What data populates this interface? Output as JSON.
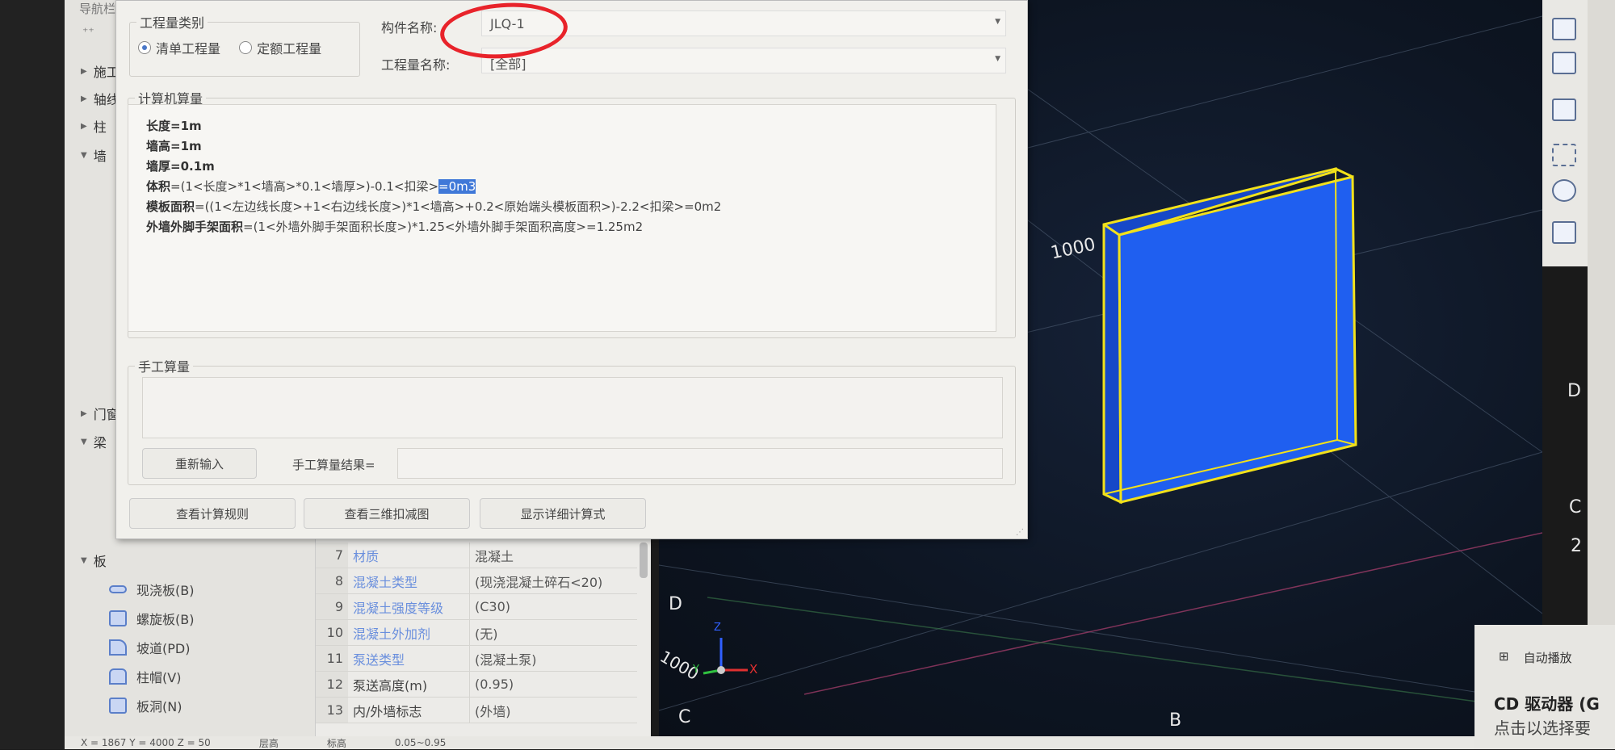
{
  "nav": {
    "title": "导航栏",
    "items": [
      {
        "label": "施工",
        "expanded": false
      },
      {
        "label": "轴线",
        "expanded": false
      },
      {
        "label": "柱",
        "expanded": false
      },
      {
        "label": "墙",
        "expanded": true
      },
      {
        "label": "门窗",
        "expanded": false
      },
      {
        "label": "梁",
        "expanded": true
      },
      {
        "label": "板",
        "expanded": true
      }
    ],
    "slab_items": [
      {
        "label": "现浇板(B)",
        "icon": "cast-slab-icon"
      },
      {
        "label": "螺旋板(B)",
        "icon": "spiral-slab-icon"
      },
      {
        "label": "坡道(PD)",
        "icon": "ramp-icon"
      },
      {
        "label": "柱帽(V)",
        "icon": "column-cap-icon"
      },
      {
        "label": "板洞(N)",
        "icon": "slab-hole-icon"
      }
    ]
  },
  "dialog": {
    "category_legend": "工程量类别",
    "radio_bill": "清单工程量",
    "radio_quota": "定额工程量",
    "selected": "清单工程量",
    "component_label": "构件名称:",
    "component_value": "JLQ-1",
    "quantity_label": "工程量名称:",
    "quantity_value": "[全部]",
    "computer_legend": "计算机算量",
    "lines": {
      "l1": "长度=1m",
      "l2": "墙高=1m",
      "l3": "墙厚=0.1m",
      "l4a": "体积",
      "l4b": "=(1<长度>*1<墙高>*0.1<墙厚>)-0.1<扣梁>",
      "l4c": "=0m3",
      "l5a": "模板面积",
      "l5b": "=((1<左边线长度>+1<右边线长度>)*1<墙高>+0.2<原始端头模板面积>)-2.2<扣梁>=0m2",
      "l6a": "外墙外脚手架面积",
      "l6b": "=(1<外墙外脚手架面积长度>)*1.25<外墙外脚手架面积高度>=1.25m2"
    },
    "manual_legend": "手工算量",
    "reinput": "重新输入",
    "manual_result_label": "手工算量结果=",
    "manual_result_value": "",
    "btn_rules": "查看计算规则",
    "btn_3d": "查看三维扣减图",
    "btn_detail": "显示详细计算式"
  },
  "props": {
    "rows": [
      {
        "n": "7",
        "name": "材质",
        "value": "混凝土",
        "link": true
      },
      {
        "n": "8",
        "name": "混凝土类型",
        "value": "(现浇混凝土碎石<20)",
        "link": true
      },
      {
        "n": "9",
        "name": "混凝土强度等级",
        "value": "(C30)",
        "link": true
      },
      {
        "n": "10",
        "name": "混凝土外加剂",
        "value": "(无)",
        "link": true
      },
      {
        "n": "11",
        "name": "泵送类型",
        "value": "(混凝土泵)",
        "link": true
      },
      {
        "n": "12",
        "name": "泵送高度(m)",
        "value": "(0.95)",
        "link": false
      },
      {
        "n": "13",
        "name": "内/外墙标志",
        "value": "(外墙)",
        "link": false
      }
    ]
  },
  "viewport": {
    "dim_label": "1000",
    "dim_label2": "1000",
    "axis_D1": "D",
    "axis_C1": "C",
    "axis_2": "2",
    "axis_D2": "D",
    "axis_C2": "C",
    "axis_B": "B",
    "gizmo_x": "X",
    "gizmo_y": "Y",
    "gizmo_z": "Z",
    "wall_color": "#1f5ff0",
    "outline_color": "#f2e11a",
    "bg_color": "#0d1522"
  },
  "status": {
    "coords": "X = 1867 Y = 4000 Z = 50",
    "floor": "层高",
    "elev": "标高",
    "range": "0.05~0.95"
  },
  "toast": {
    "title": "自动播放",
    "heading": "CD 驱动器 (G",
    "body": "点击以选择要"
  }
}
